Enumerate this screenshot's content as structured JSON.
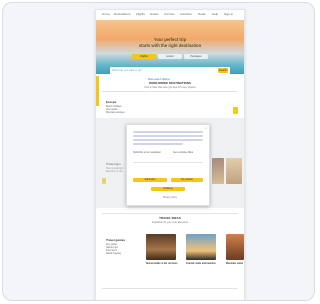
{
  "nav": {
    "links": [
      "Home",
      "Destinations",
      "Flights",
      "Hotels",
      "Car hire",
      "Activities",
      "Deals",
      "Help",
      "Sign in"
    ]
  },
  "hero": {
    "title": "Your perfect trip",
    "subtitle": "starts with the right destination",
    "tabs": [
      "Flights",
      "Hotels",
      "Packages"
    ],
    "search_placeholder": "Where do you want to go?",
    "search_button": "Search",
    "link": "More search options"
  },
  "destinations": {
    "title": "WORLDWIDE DESTINATIONS",
    "subtitle": "Find a place that suits you best for every season",
    "block_label": "Europe",
    "lines": [
      "Beach holidays",
      "City breaks",
      "Mountain escapes"
    ],
    "arrow": "›"
  },
  "modal": {
    "close": "×",
    "text_left": "Subscribe to our newsletter",
    "text_right": "Get exclusive offers",
    "button_primary": "Subscribe",
    "button_secondary": "No, thanks",
    "button_center": "Continue",
    "footer": "Privacy policy"
  },
  "middle": {
    "label": "Travel tips",
    "lines": [
      "How to pack light",
      "Best time to visit"
    ]
  },
  "ideas": {
    "title": "TRAVEL IDEAS",
    "subtitle": "Inspiration for your next adventure",
    "block_label": "Travel guides",
    "list": [
      "City guides",
      "Nature trips",
      "Food tours",
      "Island hopping"
    ],
    "captions": [
      "Sunset walks in the old town",
      "Coastal roads and beaches",
      "Mountain views"
    ]
  }
}
